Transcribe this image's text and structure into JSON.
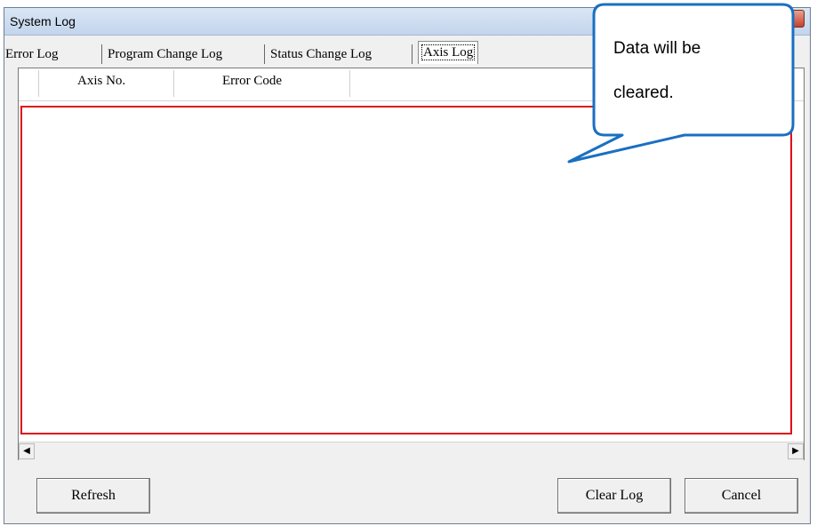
{
  "window": {
    "title": "System Log"
  },
  "tabs": [
    {
      "label": "Error Log",
      "active": false
    },
    {
      "label": "Program Change Log",
      "active": false
    },
    {
      "label": "Status Change Log",
      "active": false
    },
    {
      "label": "Axis Log",
      "active": true
    }
  ],
  "table": {
    "columns": [
      "Axis No.",
      "Error Code"
    ],
    "rows": []
  },
  "buttons": {
    "refresh": "Refresh",
    "clear_log": "Clear Log",
    "cancel": "Cancel"
  },
  "callout": {
    "line1": "Data will be",
    "line2": "cleared."
  },
  "colors": {
    "highlight_border": "#e0101a",
    "callout_border": "#1a6fc2"
  },
  "icons": {
    "close": "close-icon",
    "scroll_left": "arrow-left-icon",
    "scroll_right": "arrow-right-icon"
  }
}
